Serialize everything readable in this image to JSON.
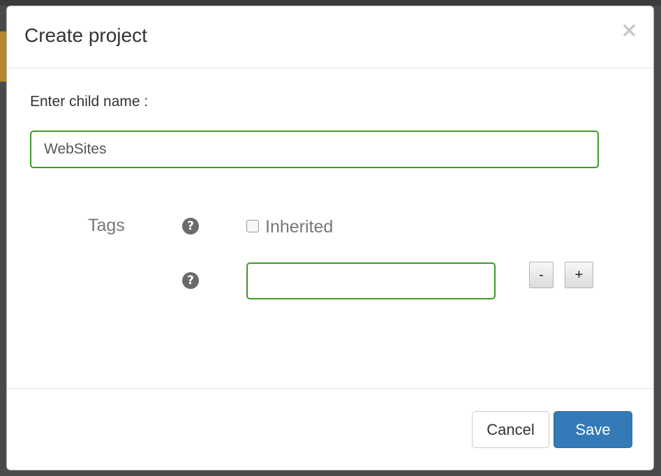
{
  "dialog": {
    "title": "Create project",
    "close_symbol": "×"
  },
  "form": {
    "child_name_label": "Enter child name :",
    "child_name_value": "WebSites",
    "tags_label": "Tags",
    "help_symbol": "?",
    "inherited_label": "Inherited",
    "inherited_checked": false,
    "tag_value": "",
    "remove_symbol": "-",
    "add_symbol": "+"
  },
  "footer": {
    "cancel_label": "Cancel",
    "save_label": "Save"
  },
  "colors": {
    "input_border": "#3c9a27",
    "primary_button": "#337ab7",
    "help_icon": "#6b6b6b"
  },
  "icons": {
    "close": "close-icon",
    "help": "question-circle-icon"
  }
}
